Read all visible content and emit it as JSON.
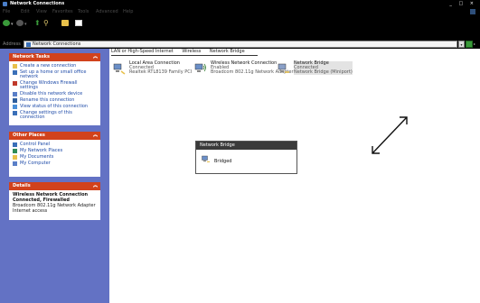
{
  "window": {
    "title": "Network Connections",
    "controls": "_ □ ×"
  },
  "menu": [
    "File",
    "Edit",
    "View",
    "Favorites",
    "Tools",
    "Advanced",
    "Help"
  ],
  "toolbar": {
    "back_label": "Back",
    "forward_label": "Forward"
  },
  "address": {
    "label": "Address",
    "value": "Network Connections"
  },
  "sidebar": {
    "network_tasks": {
      "title": "Network Tasks",
      "items": [
        "Create a new connection",
        "Set up a home or small office network",
        "Change Windows Firewall settings",
        "Disable this network device",
        "Rename this connection",
        "View status of this connection",
        "Change settings of this connection"
      ]
    },
    "other_places": {
      "title": "Other Places",
      "items": [
        "Control Panel",
        "My Network Places",
        "My Documents",
        "My Computer"
      ]
    },
    "details": {
      "title": "Details",
      "lines": [
        "Wireless Network Connection",
        "Connected, Firewalled",
        "Broadcom 802.11g Network Adapter",
        "Internet access"
      ]
    }
  },
  "columns": [
    "LAN or High-Speed Internet",
    "Wireless",
    "Network Bridge"
  ],
  "items": [
    {
      "name": "Local Area Connection",
      "status": "Connected",
      "device": "Realtek RTL8139 Family PCI"
    },
    {
      "name": "Wireless Network Connection",
      "status": "Enabled",
      "device": "Broadcom 802.11g Network Adapter"
    },
    {
      "name": "Network Bridge",
      "status": "Connected",
      "device": "Network Bridge (Miniport)"
    }
  ],
  "popup": {
    "title": "Network Bridge",
    "item_label": "Bridged"
  }
}
